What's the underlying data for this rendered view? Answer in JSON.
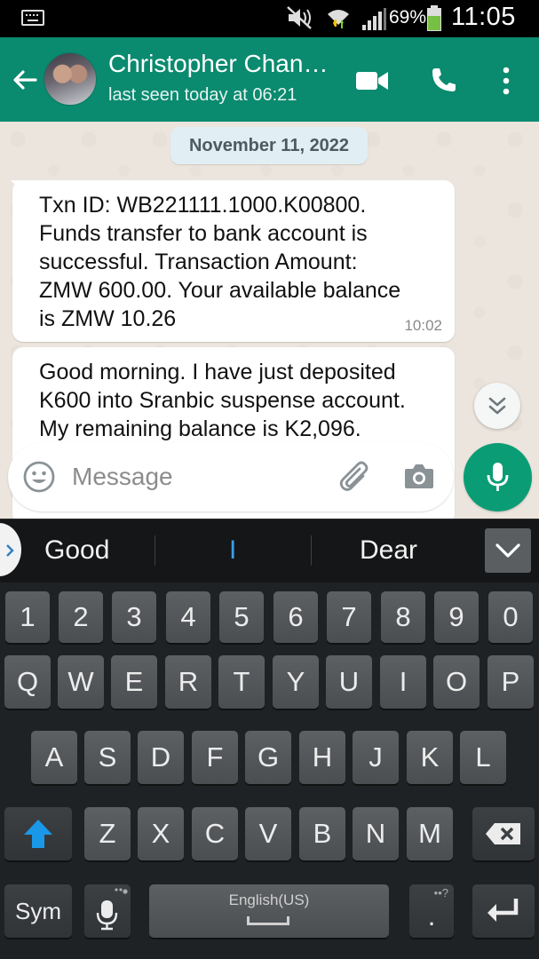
{
  "status_bar": {
    "battery_percent": "69%",
    "time": "11:05",
    "icons": [
      "keyboard-icon",
      "mute-icon",
      "wifi-icon",
      "signal-icon",
      "battery-icon"
    ]
  },
  "app_bar": {
    "contact_name": "Christopher Chan…",
    "last_seen": "last seen today at 06:21",
    "accent_color": "#0a8a6f"
  },
  "chat": {
    "date_chip": "November 11, 2022",
    "messages": [
      {
        "lines": [
          "Txn ID: WB221111.1000.K00800.",
          "Funds transfer to bank account is",
          "successful. Transaction Amount:",
          "ZMW 600.00. Your available balance",
          "is ZMW 10.26"
        ],
        "time": "10:02"
      },
      {
        "lines": [
          "Good morning. I have just deposited",
          "K600 into Sranbic suspense account.",
          "My remaining balance is K2,096."
        ],
        "time": ""
      }
    ]
  },
  "composer": {
    "placeholder": "Message",
    "mic_color": "#0a9d75"
  },
  "keyboard": {
    "suggestions": [
      "Good",
      "I",
      "Dear"
    ],
    "number_row": [
      "1",
      "2",
      "3",
      "4",
      "5",
      "6",
      "7",
      "8",
      "9",
      "0"
    ],
    "row1": [
      "Q",
      "W",
      "E",
      "R",
      "T",
      "Y",
      "U",
      "I",
      "O",
      "P"
    ],
    "row2": [
      "A",
      "S",
      "D",
      "F",
      "G",
      "H",
      "J",
      "K",
      "L"
    ],
    "row3": [
      "Z",
      "X",
      "C",
      "V",
      "B",
      "N",
      "M"
    ],
    "sym_label": "Sym",
    "space_label": "English(US)",
    "period_label": "."
  }
}
